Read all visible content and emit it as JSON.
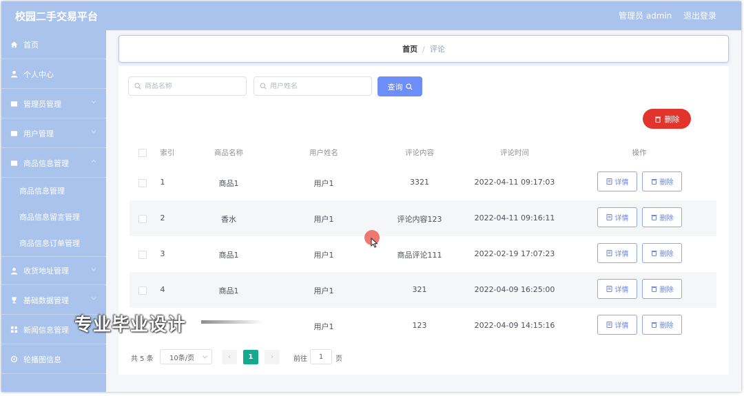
{
  "app": {
    "title": "校园二手交易平台"
  },
  "header": {
    "admin_label": "管理员 admin",
    "logout": "退出登录"
  },
  "sidebar": {
    "items": [
      {
        "label": "首页",
        "icon": "home-icon"
      },
      {
        "label": "个人中心",
        "icon": "user-icon"
      },
      {
        "label": "管理员管理",
        "icon": "folder-icon"
      },
      {
        "label": "用户管理",
        "icon": "folder-icon"
      },
      {
        "label": "商品信息管理",
        "icon": "folder-icon",
        "expanded": true
      },
      {
        "label": "收货地址管理",
        "icon": "user-icon"
      },
      {
        "label": "基础数据管理",
        "icon": "trophy-icon"
      },
      {
        "label": "新闻信息管理",
        "icon": "grid-icon"
      },
      {
        "label": "轮播图信息",
        "icon": "settings-icon"
      }
    ],
    "subitems": [
      {
        "label": "商品信息管理"
      },
      {
        "label": "商品信息留言管理"
      },
      {
        "label": "商品信息订单管理"
      }
    ]
  },
  "breadcrumb": {
    "home": "首页",
    "separator": "/",
    "current": "评论"
  },
  "search": {
    "product_placeholder": "商品名称",
    "user_placeholder": "用户姓名",
    "query_label": "查询"
  },
  "toolbar": {
    "delete_label": "删除"
  },
  "table": {
    "columns": [
      "索引",
      "商品名称",
      "用户姓名",
      "评论内容",
      "评论时间",
      "操作"
    ],
    "rows": [
      {
        "index": "1",
        "product": "商品1",
        "user": "用户1",
        "comment": "3321",
        "time": "2022-04-11 09:17:03"
      },
      {
        "index": "2",
        "product": "香水",
        "user": "用户1",
        "comment": "评论内容123",
        "time": "2022-04-11 09:16:11"
      },
      {
        "index": "3",
        "product": "商品1",
        "user": "用户1",
        "comment": "商品评论111",
        "time": "2022-02-19 17:07:23"
      },
      {
        "index": "4",
        "product": "商品1",
        "user": "用户1",
        "comment": "321",
        "time": "2022-04-09 16:25:00"
      },
      {
        "index": "",
        "product": "",
        "user": "用户1",
        "comment": "123",
        "time": "2022-04-09 14:15:16"
      }
    ],
    "detail_label": "详情",
    "delete_label": "删除"
  },
  "pagination": {
    "total": "共 5 条",
    "page_size": "10条/页",
    "prev": "‹",
    "current": "1",
    "next": "›",
    "goto": "前往",
    "goto_value": "1",
    "page_unit": "页"
  },
  "watermark": "专业毕业设计",
  "colors": {
    "sidebar": "#a9c3ec",
    "primary": "#6d8ef6",
    "danger": "#e0342c",
    "page_active": "#17a98e"
  }
}
